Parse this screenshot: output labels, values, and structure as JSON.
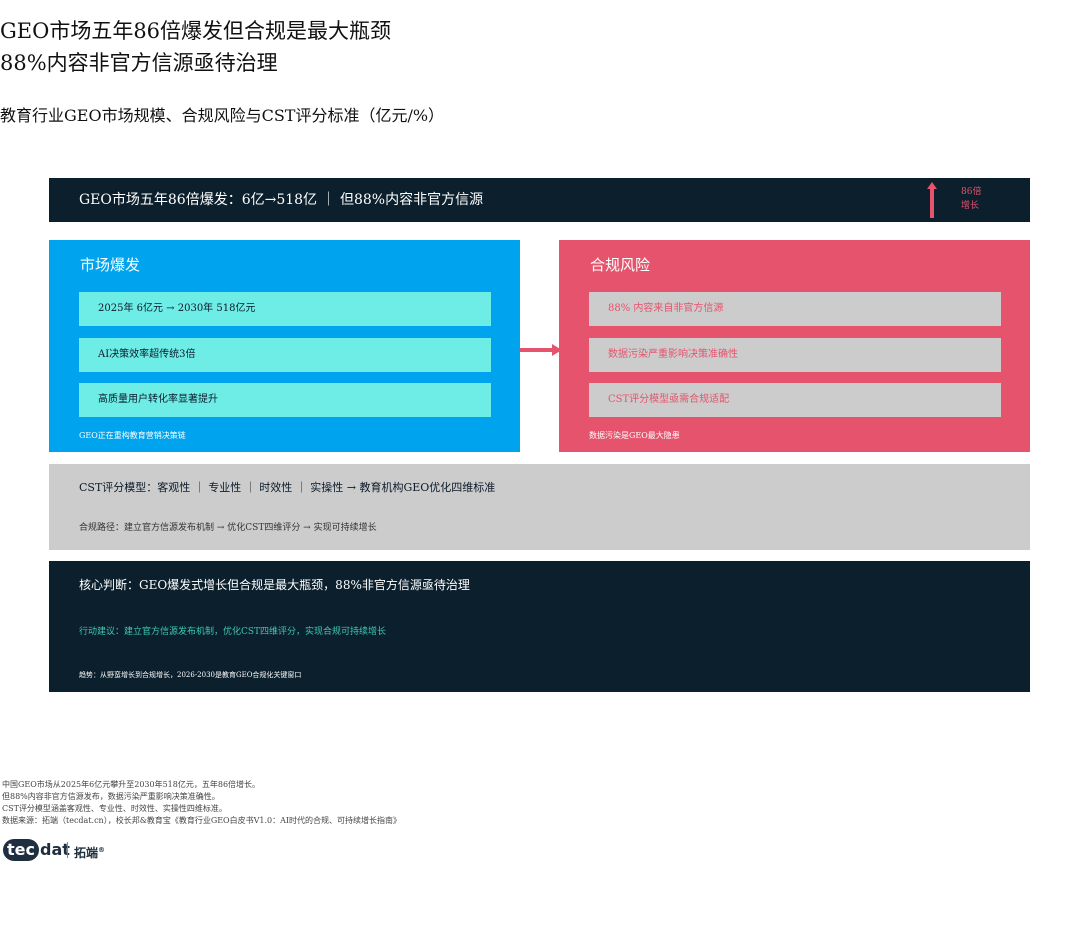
{
  "header": {
    "title_line1": "GEO市场五年86倍爆发但合规是最大瓶颈",
    "title_line2": "88%内容非官方信源亟待治理",
    "subtitle": "教育行业GEO市场规模、合规风险与CST评分标准（亿元/%）"
  },
  "banner": {
    "text": "GEO市场五年86倍爆发：6亿→518亿 ｜ 但88%内容非官方信源",
    "growth_label_line1": "86倍",
    "growth_label_line2": "增长",
    "arrow_color": "#e5546c"
  },
  "left_panel": {
    "title": "市场爆发",
    "items": [
      "2025年 6亿元 → 2030年 518亿元",
      "AI决策效率超传统3倍",
      "高质量用户转化率显著提升"
    ],
    "footer": "GEO正在重构教育营销决策链",
    "color": "#00a3ee"
  },
  "right_panel": {
    "title": "合规风险",
    "items": [
      "88% 内容来自非官方信源",
      "数据污染严重影响决策准确性",
      "CST评分模型亟需合规适配"
    ],
    "footer": "数据污染是GEO最大隐患",
    "color": "#e5546c"
  },
  "cst_band": {
    "line1": "CST评分模型：客观性 ｜ 专业性 ｜ 时效性 ｜ 实操性 → 教育机构GEO优化四维标准",
    "line2": "合规路径：建立官方信源发布机制 → 优化CST四维评分 → 实现可持续增长"
  },
  "judgement": {
    "title": "核心判断：GEO爆发式增长但合规是最大瓶颈，88%非官方信源亟待治理",
    "action": "行动建议：建立官方信源发布机制，优化CST四维评分，实现合规可持续增长",
    "trend": "趋势：从野蛮增长到合规增长，2026-2030是教育GEO合规化关键窗口"
  },
  "notes": [
    "中国GEO市场从2025年6亿元攀升至2030年518亿元，五年86倍增长。",
    "但88%内容非官方信源发布，数据污染严重影响决策准确性。",
    "CST评分模型涵盖客观性、专业性、时效性、实操性四维标准。",
    "数据来源：拓端（tecdat.cn），校长邦&教育宝《教育行业GEO白皮书V1.0：AI时代的合规、可持续增长指南》"
  ],
  "logo": {
    "tec": "tec",
    "dat": "dat",
    "cn": "拓端",
    "mark": "®"
  }
}
